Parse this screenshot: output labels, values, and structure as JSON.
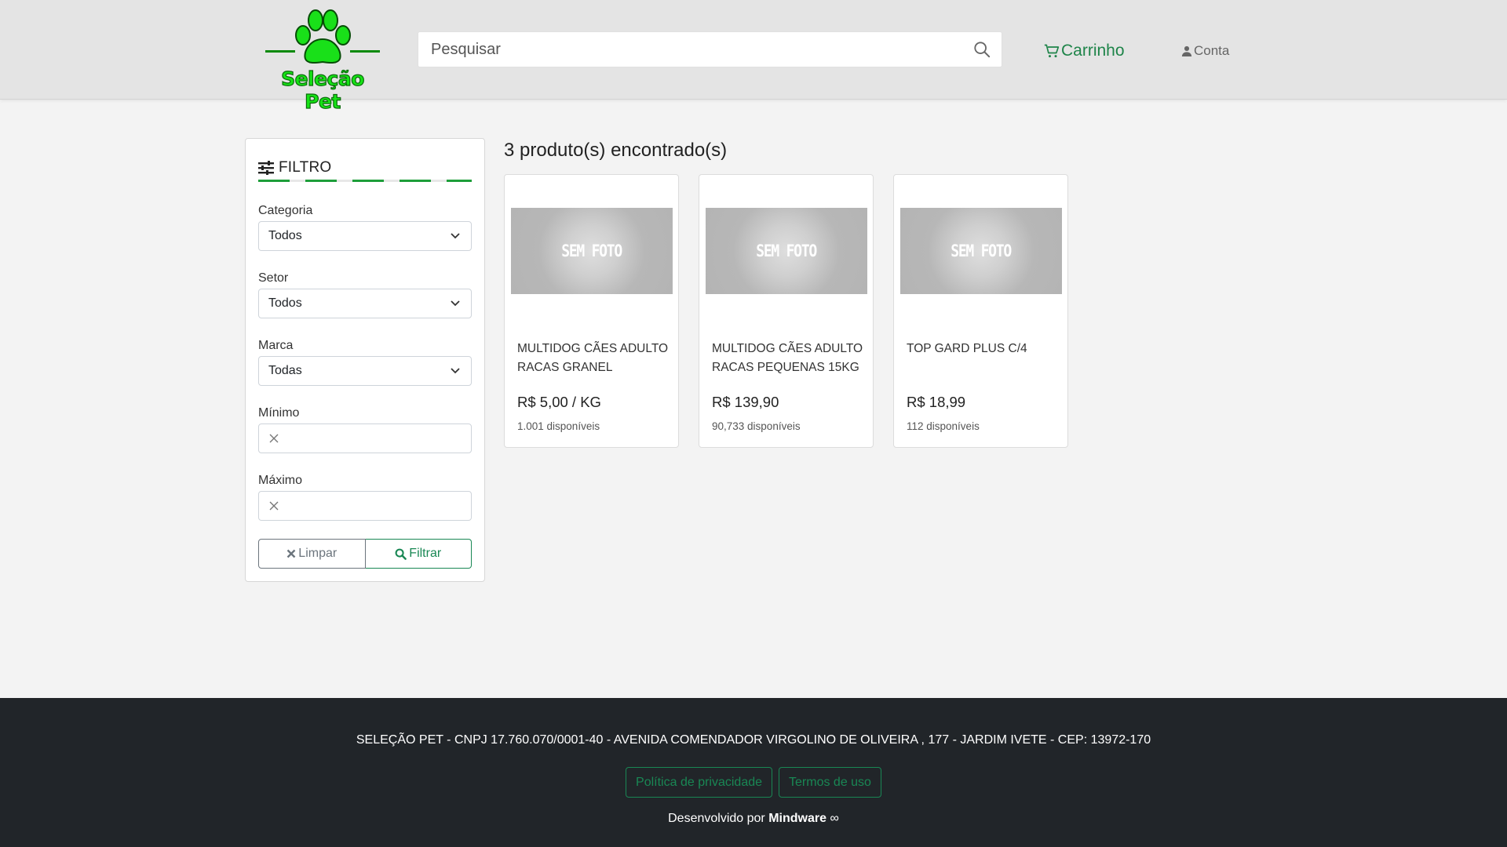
{
  "brand": {
    "name": "Seleção Pet",
    "color": "#16e316"
  },
  "header": {
    "search_placeholder": "Pesquisar",
    "cart_label": "Carrinho",
    "account_label": "Conta"
  },
  "filter": {
    "title": "FILTRO",
    "category": {
      "label": "Categoria",
      "value": "Todos"
    },
    "sector": {
      "label": "Setor",
      "value": "Todos"
    },
    "brand": {
      "label": "Marca",
      "value": "Todas"
    },
    "min": {
      "label": "Mínimo",
      "value": ""
    },
    "max": {
      "label": "Máximo",
      "value": ""
    },
    "clear_label": "Limpar",
    "apply_label": "Filtrar"
  },
  "results": {
    "title": "3 produto(s) encontrado(s)",
    "products": [
      {
        "photo": "SEM FOTO",
        "name": "MULTIDOG CÃES ADULTO RACAS GRANEL",
        "price": "R$ 5,00 / KG",
        "stock": "1.001 disponíveis"
      },
      {
        "photo": "SEM FOTO",
        "name": "MULTIDOG CÃES ADULTO RACAS PEQUENAS 15KG",
        "price": "R$ 139,90",
        "stock": "90,733 disponíveis"
      },
      {
        "photo": "SEM FOTO",
        "name": "TOP GARD PLUS C/4",
        "price": "R$ 18,99",
        "stock": "112 disponíveis"
      }
    ]
  },
  "footer": {
    "company": "SELEÇÃO PET - CNPJ 17.760.070/0001-40 - AVENIDA COMENDADOR VIRGOLINO DE OLIVEIRA , 177 - JARDIM IVETE - CEP: 13972-170",
    "privacy_label": "Política de privacidade",
    "terms_label": "Termos de uso",
    "dev_prefix": "Desenvolvido por",
    "dev_name": "Mindware",
    "dev_symbol": "∞"
  },
  "colors": {
    "accent": "#198754",
    "footer_bg": "#212529",
    "header_bg": "#e4e4e4"
  }
}
